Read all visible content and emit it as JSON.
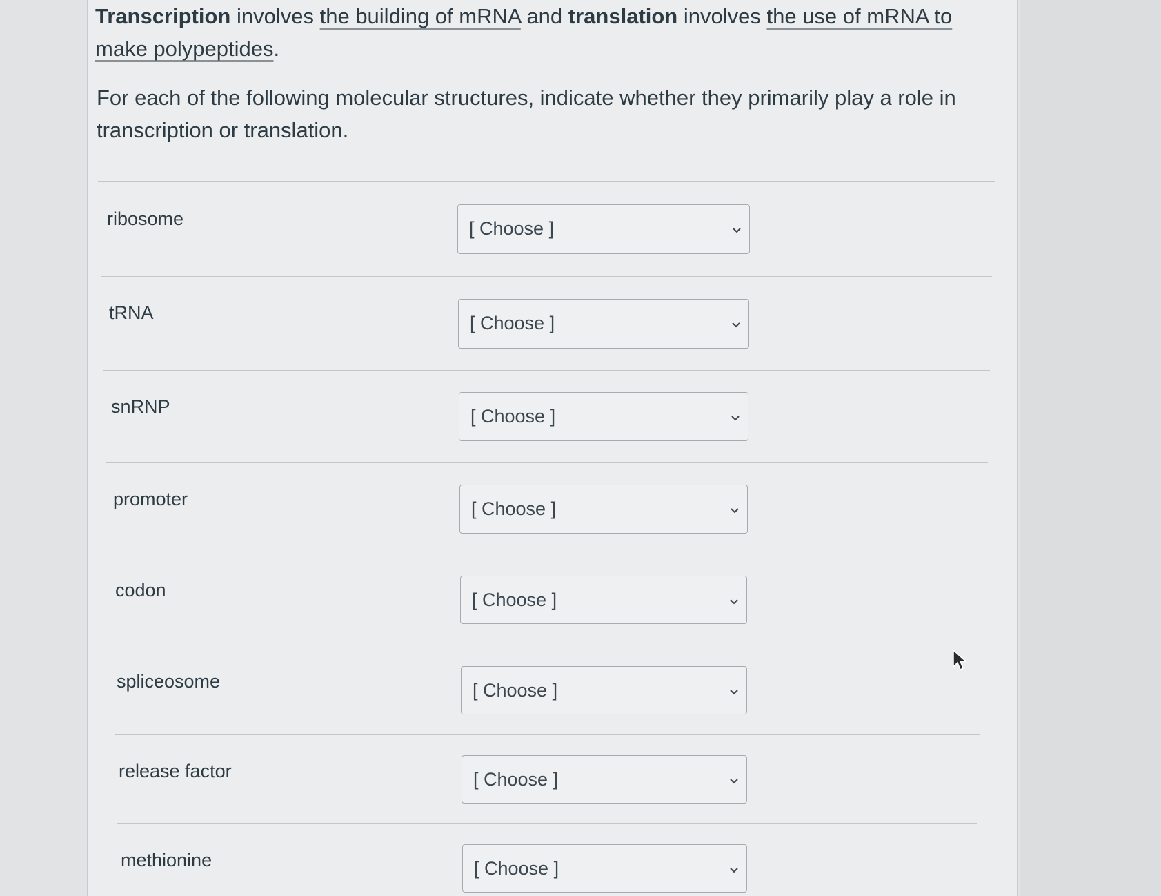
{
  "intro": {
    "w1": "Transcription",
    "w2": " involves ",
    "w3": "the building of mRNA",
    "w4": " and ",
    "w5": "translation",
    "w6": " involves ",
    "w7": "the use of mRNA to make polypeptides",
    "w8": "."
  },
  "prompt": "For each of the following molecular structures, indicate whether they primarily play a role in transcription or translation.",
  "rows": [
    {
      "label": "ribosome",
      "selected": "[ Choose ]"
    },
    {
      "label": "tRNA",
      "selected": "[ Choose ]"
    },
    {
      "label": "snRNP",
      "selected": "[ Choose ]"
    },
    {
      "label": "promoter",
      "selected": "[ Choose ]"
    },
    {
      "label": "codon",
      "selected": "[ Choose ]"
    },
    {
      "label": "spliceosome",
      "selected": "[ Choose ]"
    },
    {
      "label": "release factor",
      "selected": "[ Choose ]"
    },
    {
      "label": "methionine",
      "selected": "[ Choose ]"
    }
  ],
  "icons": {
    "dropdown": "chevron-down-icon",
    "cursor": "mouse-pointer-icon"
  },
  "colors": {
    "text": "#2d3b45",
    "card_bg": "#ecedee",
    "border": "#a6abb0"
  }
}
